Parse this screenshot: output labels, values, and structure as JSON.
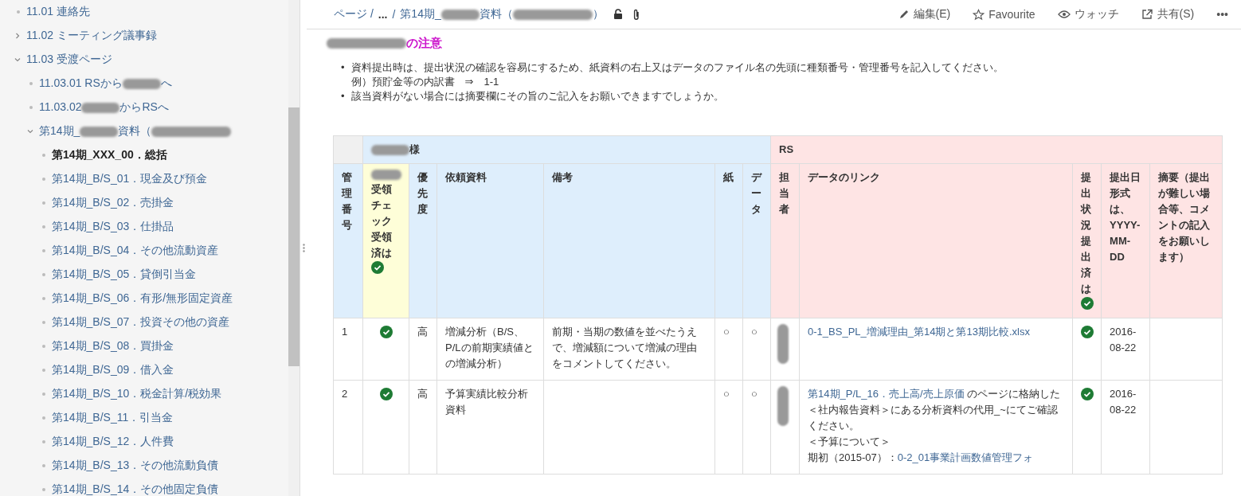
{
  "sidebar": {
    "items": [
      {
        "kind": "leaf",
        "label_parts": [
          "11.01 連絡先"
        ],
        "current": false
      },
      {
        "kind": "folder",
        "label_parts": [
          "11.02 ミーティング議事録"
        ],
        "current": false,
        "expanded": false
      },
      {
        "kind": "folder",
        "label_parts": [
          "11.03 受渡ページ"
        ],
        "current": false,
        "expanded": true,
        "children": [
          {
            "kind": "leaf",
            "label_parts": [
              "11.03.01 RSから",
              "へ"
            ],
            "current": false
          },
          {
            "kind": "leaf",
            "label_parts": [
              "11.03.02",
              "からRSへ"
            ],
            "current": false
          },
          {
            "kind": "folder",
            "label_parts": [
              "第14期_",
              "資料（"
            ],
            "current": false,
            "expanded": true,
            "children": [
              {
                "kind": "leaf",
                "label_parts": [
                  "第14期_XXX_00．総括"
                ],
                "current": true
              },
              {
                "kind": "leaf",
                "label_parts": [
                  "第14期_B/S_01．現金及び預金"
                ],
                "current": false
              },
              {
                "kind": "leaf",
                "label_parts": [
                  "第14期_B/S_02．売掛金"
                ],
                "current": false
              },
              {
                "kind": "leaf",
                "label_parts": [
                  "第14期_B/S_03．仕掛品"
                ],
                "current": false
              },
              {
                "kind": "leaf",
                "label_parts": [
                  "第14期_B/S_04．その他流動資産"
                ],
                "current": false
              },
              {
                "kind": "leaf",
                "label_parts": [
                  "第14期_B/S_05．貸倒引当金"
                ],
                "current": false
              },
              {
                "kind": "leaf",
                "label_parts": [
                  "第14期_B/S_06．有形/無形固定資産"
                ],
                "current": false
              },
              {
                "kind": "leaf",
                "label_parts": [
                  "第14期_B/S_07．投資その他の資産"
                ],
                "current": false
              },
              {
                "kind": "leaf",
                "label_parts": [
                  "第14期_B/S_08．買掛金"
                ],
                "current": false
              },
              {
                "kind": "leaf",
                "label_parts": [
                  "第14期_B/S_09．借入金"
                ],
                "current": false
              },
              {
                "kind": "leaf",
                "label_parts": [
                  "第14期_B/S_10．税金計算/税効果"
                ],
                "current": false
              },
              {
                "kind": "leaf",
                "label_parts": [
                  "第14期_B/S_11．引当金"
                ],
                "current": false
              },
              {
                "kind": "leaf",
                "label_parts": [
                  "第14期_B/S_12．人件費"
                ],
                "current": false
              },
              {
                "kind": "leaf",
                "label_parts": [
                  "第14期_B/S_13．その他流動負債"
                ],
                "current": false
              },
              {
                "kind": "leaf",
                "label_parts": [
                  "第14期_B/S_14．その他固定負債"
                ],
                "current": false
              }
            ]
          }
        ]
      }
    ]
  },
  "breadcrumb": {
    "root": "ページ /",
    "ellipsis": "...",
    "separator": "/",
    "title_parts": [
      "第14期_",
      "資料（",
      "）"
    ]
  },
  "actions": [
    {
      "kind": "edit",
      "label": "編集(E)"
    },
    {
      "kind": "favourite",
      "label": "Favourite"
    },
    {
      "kind": "watch",
      "label": "ウォッチ"
    },
    {
      "kind": "share",
      "label": "共有(S)"
    },
    {
      "kind": "more",
      "label": "•••"
    }
  ],
  "notice": {
    "title": "の注意",
    "bullets": [
      {
        "marker": "•",
        "lines": [
          "資料提出時は、提出状況の確認を容易にするため、紙資料の右上又はデータのファイル名の先頭に種類番号・管理番号を記入してください。",
          "例）預貯金等の内訳書　⇒　1-1"
        ]
      },
      {
        "marker": "•",
        "lines": [
          "該当資料がない場合には摘要欄にその旨のご記入をお願いできますでしょうか。"
        ]
      }
    ]
  },
  "table": {
    "groups": [
      {
        "kind": "blank",
        "columns": [
          {
            "label": "管理番号",
            "highlighted": false,
            "kind": "text"
          }
        ]
      },
      {
        "kind": "client",
        "label": "様",
        "columns": [
          {
            "label": "受領チェック受領済は",
            "highlighted": true,
            "kind": "check"
          },
          {
            "label": "優先度",
            "highlighted": false,
            "kind": "text"
          },
          {
            "label": "依頼資料",
            "highlighted": false,
            "kind": "text"
          },
          {
            "label": "備考",
            "highlighted": false,
            "kind": "text"
          },
          {
            "label": "紙",
            "highlighted": false,
            "kind": "text"
          },
          {
            "label": "データ",
            "highlighted": false,
            "kind": "text"
          }
        ]
      },
      {
        "kind": "rs",
        "label": "RS",
        "columns": [
          {
            "label": "担当者",
            "highlighted": false,
            "kind": "person"
          },
          {
            "label": "データのリンク",
            "highlighted": false,
            "kind": "links"
          },
          {
            "label": "提出状況提出済は",
            "highlighted": false,
            "kind": "check"
          },
          {
            "label": "提出日形式は、YYYY-MM-DD",
            "highlighted": false,
            "kind": "text"
          },
          {
            "label": "摘要（提出が難しい場合等、コメントの記入をお願いします）",
            "highlighted": false,
            "kind": "text"
          }
        ]
      }
    ],
    "rows": [
      {
        "cells": [
          {
            "text": "1"
          },
          {
            "checked": true
          },
          {
            "text": "高"
          },
          {
            "text": "増減分析（B/S、P/Lの前期実績値との増減分析）"
          },
          {
            "text": "前期・当期の数値を並べたうえで、増減額について増減の理由をコメントしてください。"
          },
          {
            "text": "○"
          },
          {
            "text": "○"
          },
          {},
          {
            "lines": [
              [
                {
                  "text": "0-1_BS_PL_増減理由_第14期と第13期比較.xlsx",
                  "link": true
                }
              ]
            ]
          },
          {
            "checked": true
          },
          {
            "text": "2016-08-22"
          },
          {}
        ]
      },
      {
        "cells": [
          {
            "text": "2"
          },
          {
            "checked": true
          },
          {
            "text": "高"
          },
          {
            "text": "予算実績比較分析資料"
          },
          {},
          {
            "text": "○"
          },
          {
            "text": "○"
          },
          {},
          {
            "lines": [
              [
                {
                  "text": "第14期_P/L_16．売上高/売上原価",
                  "link": true
                },
                {
                  "text": " のページに格納した＜社内報告資料＞にある分析資料の代用_~にてご確認ください。",
                  "link": false
                }
              ],
              [
                {
                  "text": "＜予算について＞",
                  "link": false
                }
              ],
              [
                {
                  "text": "期初（2015-07）：",
                  "link": false
                },
                {
                  "text": "0-2_01事業計画数値管理フォ",
                  "link": true
                }
              ]
            ]
          },
          {
            "checked": true
          },
          {
            "text": "2016-08-22"
          },
          {}
        ]
      }
    ]
  }
}
